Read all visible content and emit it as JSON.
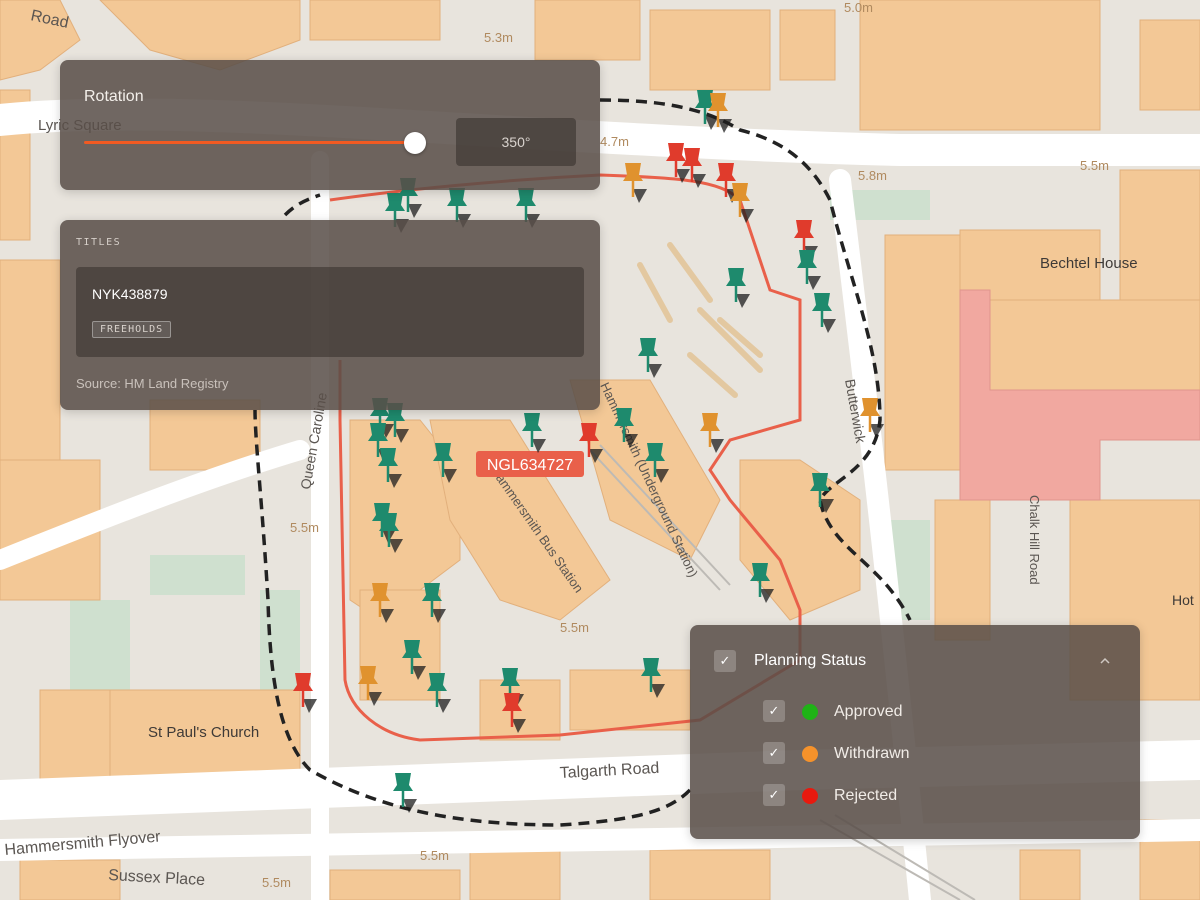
{
  "rotation": {
    "label": "Rotation",
    "value_text": "350°",
    "value_deg": 350,
    "max_deg": 360
  },
  "titles": {
    "heading": "TITLES",
    "title_number": "NYK438879",
    "tenure": "FREEHOLDS",
    "source": "Source: HM Land Registry"
  },
  "map": {
    "street_labels": {
      "queen_caroline": "Queen Caroline",
      "talgarth_road": "Talgarth Road",
      "hammersmith_flyover": "Hammersmith Flyover",
      "sussex_place": "Sussex Place",
      "butterwick": "Butterwick",
      "chalk_hill_road": "Chalk Hill Road",
      "lyric_square": "Lyric Square",
      "top_road": "Road"
    },
    "place_labels": {
      "bechtel": "Bechtel House",
      "st_pauls": "St Paul's Church",
      "bus_station": "Hammersmith Bus Station",
      "underground": "Hammersmith (Underground Station)",
      "hotel": "Hot"
    },
    "heights": [
      "5.3m",
      "5.0m",
      "4.7m",
      "5.5m",
      "5.8m",
      "5.5m",
      "5.5m",
      "5.5m",
      "5.5m"
    ],
    "parcel_label": "NGL634727",
    "colors": {
      "approved": "#1e8a6d",
      "withdrawn": "#e0922e",
      "rejected": "#e03b2c",
      "parcel": "#e9604a"
    }
  },
  "legend": {
    "title": "Planning Status",
    "items": [
      {
        "label": "Approved",
        "color": "#1fb316"
      },
      {
        "label": "Withdrawn",
        "color": "#f5922b"
      },
      {
        "label": "Rejected",
        "color": "#e8190e"
      }
    ],
    "check_glyph": "✓",
    "chevron_icon": "chevron-up-icon"
  }
}
